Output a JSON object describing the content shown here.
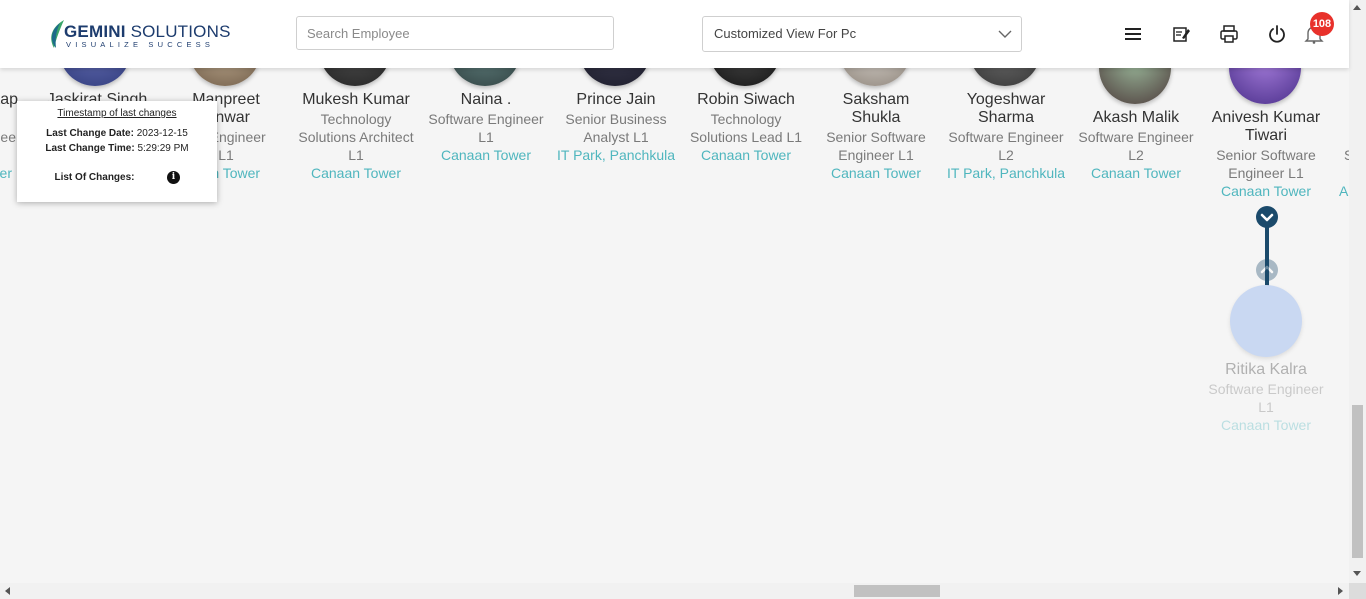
{
  "header": {
    "logo": {
      "main_bold": "GEMINI",
      "main_thin": " SOLUTIONS",
      "tagline": "VISUALIZE SUCCESS"
    },
    "search": {
      "placeholder": "Search Employee",
      "value": ""
    },
    "view_select": {
      "selected": "Customized View For Pc"
    },
    "icons": [
      "menu-icon",
      "edit-note-icon",
      "print-icon",
      "power-icon",
      "bell-icon"
    ],
    "notification_count": "108"
  },
  "tooltip": {
    "title": "Timestamp of last changes",
    "date_label": "Last Change Date:",
    "date_value": "2023-12-15",
    "time_label": "Last Change Time:",
    "time_value": "5:29:29 PM",
    "changes_label": "List Of Changes:"
  },
  "employees": [
    {
      "name": "...tap",
      "designation": "...nee",
      "location": "...er"
    },
    {
      "name": "Jaskirat Singh",
      "designation": "",
      "location": ""
    },
    {
      "name": "Manpreet ...nwar",
      "name1": "Manpreet",
      "name2": "...nwar",
      "desig1": "...e Engineer",
      "desig2": "L1",
      "location": "...an Tower"
    },
    {
      "name1": "Mukesh Kumar",
      "desig1": "Technology",
      "desig2": "Solutions Architect",
      "desig3": "L1",
      "location": "Canaan Tower"
    },
    {
      "name1": "Naina .",
      "desig1": "Software Engineer",
      "desig2": "L1",
      "location": "Canaan Tower"
    },
    {
      "name1": "Prince Jain",
      "desig1": "Senior Business",
      "desig2": "Analyst L1",
      "location": "IT Park, Panchkula"
    },
    {
      "name1": "Robin Siwach",
      "desig1": "Technology",
      "desig2": "Solutions Lead L1",
      "location": "Canaan Tower"
    },
    {
      "name1": "Saksham",
      "name2": "Shukla",
      "desig1": "Senior Software",
      "desig2": "Engineer L1",
      "location": "Canaan Tower"
    },
    {
      "name1": "Yogeshwar",
      "name2": "Sharma",
      "desig1": "Software Engineer",
      "desig2": "L2",
      "location": "IT Park, Panchkula"
    },
    {
      "name1": "Akash Malik",
      "desig1": "Software Engineer",
      "desig2": "L2",
      "location": "Canaan Tower"
    },
    {
      "name1": "Anivesh Kumar",
      "name2": "Tiwari",
      "desig1": "Senior Software",
      "desig2": "Engineer L1",
      "location": "Canaan Tower"
    },
    {
      "name1": "",
      "desig1": "S",
      "location": "A"
    }
  ],
  "child": {
    "name": "Ritika Kalra",
    "desig1": "Software Engineer",
    "desig2": "L1",
    "location": "Canaan Tower"
  },
  "colors": {
    "accent": "#4fb6be",
    "brand": "#1d3c6e",
    "badge": "#e8312b",
    "connector": "#1b4a6b"
  }
}
